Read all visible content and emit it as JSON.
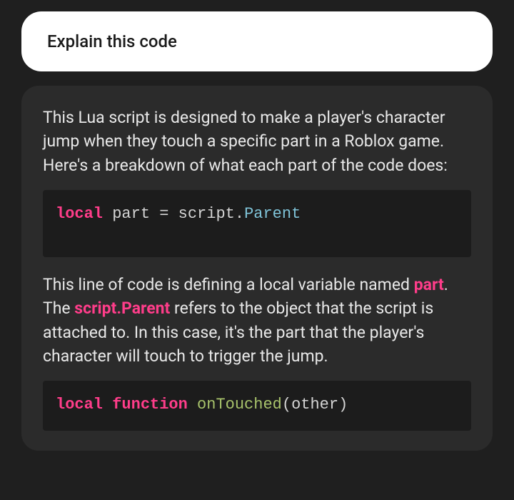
{
  "user_message": {
    "text": "Explain this code"
  },
  "assistant": {
    "intro": "This Lua script is designed to make a player's character jump when they touch a specific part in a Roblox game. Here's a breakdown of what each part of the code does:",
    "code1": {
      "kw_local": "local",
      "ident_part": " part ",
      "eq": "= ",
      "ident_script": "script",
      "dot": ".",
      "prop_parent": "Parent"
    },
    "para2_pre": "This line of code is defining a local variable named ",
    "para2_part": "part",
    "para2_mid": ". The ",
    "para2_scriptparent": "script.Parent",
    "para2_post": " refers to the object that the script is attached to. In this case, it's the part that the player's character will touch to trigger the jump.",
    "code2": {
      "kw_local": "local",
      "sp1": " ",
      "kw_function": "function",
      "sp2": " ",
      "fn_name": "onTouched",
      "paren_open": "(",
      "arg": "other",
      "paren_close": ")"
    }
  }
}
